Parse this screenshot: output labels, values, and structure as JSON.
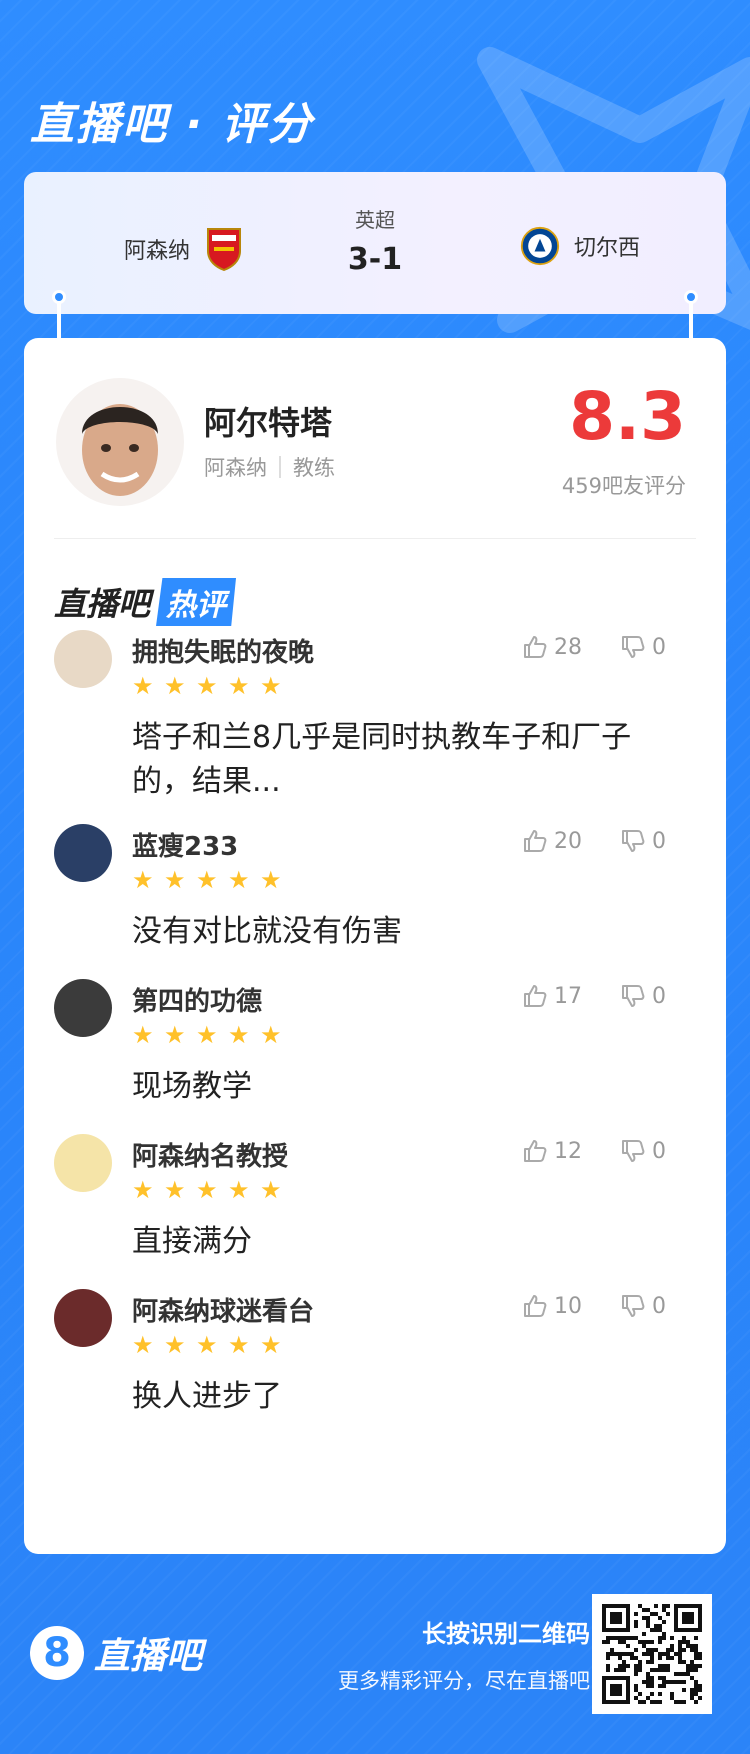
{
  "header": {
    "brand_title": "直播吧 · 评分"
  },
  "match": {
    "home_team": "阿森纳",
    "away_team": "切尔西",
    "league": "英超",
    "score": "3-1"
  },
  "player": {
    "name": "阿尔特塔",
    "team": "阿森纳",
    "role": "教练",
    "rating": "8.3",
    "rating_count": "459吧友评分"
  },
  "hot_comments": {
    "title_left": "直播吧",
    "title_right": "热评",
    "items": [
      {
        "user": "拥抱失眠的夜晚",
        "likes": "28",
        "dislikes": "0",
        "stars": 5,
        "text": "塔子和兰8几乎是同时执教车子和厂子的，结果..."
      },
      {
        "user": "蓝瘦233",
        "likes": "20",
        "dislikes": "0",
        "stars": 5,
        "text": "没有对比就没有伤害"
      },
      {
        "user": "第四的功德",
        "likes": "17",
        "dislikes": "0",
        "stars": 5,
        "text": "现场教学"
      },
      {
        "user": "阿森纳名教授",
        "likes": "12",
        "dislikes": "0",
        "stars": 5,
        "text": "直接满分"
      },
      {
        "user": "阿森纳球迷看台",
        "likes": "10",
        "dislikes": "0",
        "stars": 5,
        "text": "换人进步了"
      }
    ]
  },
  "footer": {
    "logo_number": "8",
    "logo_text": "直播吧",
    "line1": "长按识别二维码",
    "line2": "更多精彩评分，尽在直播吧"
  },
  "colors": {
    "accent": "#2f8dff",
    "rating": "#ec3a3a",
    "star": "#ffc12a"
  }
}
